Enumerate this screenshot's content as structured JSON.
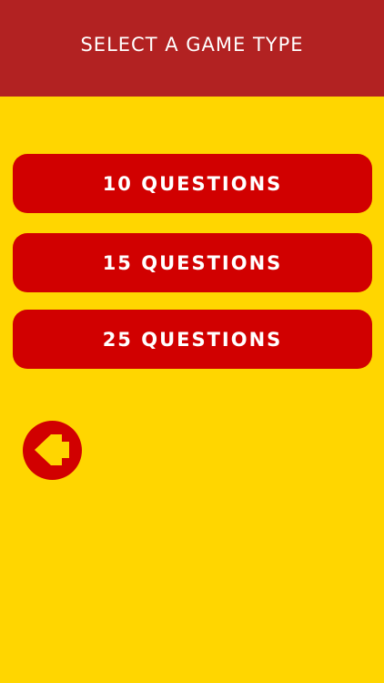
{
  "header": {
    "title": "SELECT A GAME TYPE"
  },
  "options": [
    {
      "label": "10 QUESTIONS"
    },
    {
      "label": "15 QUESTIONS"
    },
    {
      "label": "25 QUESTIONS"
    }
  ],
  "back": {
    "icon": "back-arrow-icon"
  },
  "colors": {
    "background": "#FFD600",
    "header": "#B22222",
    "button": "#D10000",
    "text": "#FFFFFF",
    "arrow": "#FFD600"
  }
}
